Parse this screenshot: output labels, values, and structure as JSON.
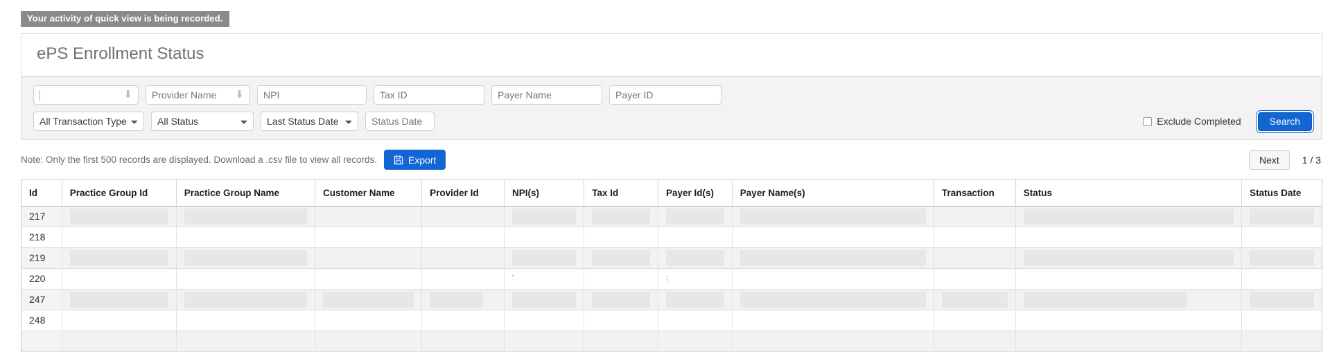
{
  "banner": {
    "text": "Your activity of quick view is being recorded."
  },
  "panel": {
    "title": "ePS Enrollment Status"
  },
  "filters": {
    "row1": [
      {
        "name": "practice-group",
        "type": "typeahead",
        "value": "",
        "placeholder": "",
        "arrow": "⬇"
      },
      {
        "name": "provider-name",
        "type": "typeahead",
        "value": "Provider Name",
        "placeholder": "Provider Name",
        "arrow": "⬇"
      },
      {
        "name": "npi",
        "type": "text",
        "value": "",
        "placeholder": "NPI"
      },
      {
        "name": "tax-id",
        "type": "text",
        "value": "",
        "placeholder": "Tax ID"
      },
      {
        "name": "payer-name",
        "type": "text",
        "value": "",
        "placeholder": "Payer Name"
      },
      {
        "name": "payer-id",
        "type": "text",
        "value": "",
        "placeholder": "Payer ID"
      }
    ],
    "row2": [
      {
        "name": "transaction-type",
        "type": "select",
        "selected": "All Transaction Types",
        "options": [
          "All Transaction Types"
        ]
      },
      {
        "name": "status",
        "type": "select",
        "selected": "All Status",
        "options": [
          "All Status"
        ]
      },
      {
        "name": "date-field",
        "type": "select",
        "selected": "Last Status Date",
        "options": [
          "Last Status Date"
        ]
      },
      {
        "name": "status-date",
        "type": "text",
        "value": "",
        "placeholder": "Status Date"
      }
    ],
    "exclude_completed_label": "Exclude Completed",
    "exclude_completed_checked": false,
    "search_label": "Search"
  },
  "toolbar": {
    "note": "Note: Only the first 500 records are displayed. Download a .csv file to view all records.",
    "export_label": "Export",
    "export_icon": "save-icon",
    "next_label": "Next",
    "page_indicator": "1 / 3"
  },
  "table": {
    "columns": [
      "Id",
      "Practice Group Id",
      "Practice Group Name",
      "Customer Name",
      "Provider Id",
      "NPI(s)",
      "Tax Id",
      "Payer Id(s)",
      "Payer Name(s)",
      "Transaction",
      "Status",
      "Status Date"
    ],
    "rows": [
      {
        "id": "217",
        "striped": true,
        "cells": [
          {
            "redacted": true,
            "fill": 1.0
          },
          {
            "redacted": true,
            "fill": 1.0
          },
          {
            "redacted": false
          },
          {
            "redacted": false
          },
          {
            "redacted": true,
            "fill": 1.0
          },
          {
            "redacted": true,
            "fill": 1.0
          },
          {
            "redacted": true,
            "fill": 1.0
          },
          {
            "redacted": true,
            "fill": 1.0
          },
          {
            "redacted": false
          },
          {
            "redacted": true,
            "fill": 1.0
          },
          {
            "redacted": true,
            "fill": 1.0
          }
        ]
      },
      {
        "id": "218",
        "striped": false,
        "cells": [
          {
            "redacted": false
          },
          {
            "redacted": false
          },
          {
            "redacted": false
          },
          {
            "redacted": false
          },
          {
            "redacted": false
          },
          {
            "redacted": false
          },
          {
            "redacted": false
          },
          {
            "redacted": false
          },
          {
            "redacted": false
          },
          {
            "redacted": false
          },
          {
            "redacted": false
          }
        ]
      },
      {
        "id": "219",
        "striped": true,
        "cells": [
          {
            "redacted": true,
            "fill": 1.0
          },
          {
            "redacted": true,
            "fill": 1.0
          },
          {
            "redacted": false
          },
          {
            "redacted": false
          },
          {
            "redacted": true,
            "fill": 1.0
          },
          {
            "redacted": true,
            "fill": 1.0
          },
          {
            "redacted": true,
            "fill": 1.0
          },
          {
            "redacted": true,
            "fill": 1.0
          },
          {
            "redacted": false
          },
          {
            "redacted": true,
            "fill": 1.0
          },
          {
            "redacted": true,
            "fill": 1.0
          }
        ]
      },
      {
        "id": "220",
        "striped": false,
        "cells": [
          {
            "redacted": false
          },
          {
            "redacted": false
          },
          {
            "redacted": false
          },
          {
            "redacted": false
          },
          {
            "redacted": false,
            "mark": "'"
          },
          {
            "redacted": false
          },
          {
            "redacted": false,
            "mark": ";"
          },
          {
            "redacted": false
          },
          {
            "redacted": false
          },
          {
            "redacted": false
          },
          {
            "redacted": false
          }
        ]
      },
      {
        "id": "247",
        "striped": true,
        "cells": [
          {
            "redacted": true,
            "fill": 1.0
          },
          {
            "redacted": true,
            "fill": 1.0
          },
          {
            "redacted": true,
            "fill": 1.0
          },
          {
            "redacted": true,
            "fill": 0.8
          },
          {
            "redacted": true,
            "fill": 1.0
          },
          {
            "redacted": true,
            "fill": 1.0
          },
          {
            "redacted": true,
            "fill": 1.0
          },
          {
            "redacted": true,
            "fill": 1.0
          },
          {
            "redacted": true,
            "fill": 1.0
          },
          {
            "redacted": true,
            "fill": 0.78
          },
          {
            "redacted": true,
            "fill": 1.0
          }
        ]
      },
      {
        "id": "248",
        "striped": false,
        "cells": [
          {
            "redacted": false
          },
          {
            "redacted": false
          },
          {
            "redacted": false
          },
          {
            "redacted": false
          },
          {
            "redacted": false
          },
          {
            "redacted": false
          },
          {
            "redacted": false
          },
          {
            "redacted": false
          },
          {
            "redacted": false
          },
          {
            "redacted": false
          },
          {
            "redacted": false
          }
        ]
      },
      {
        "id": "",
        "striped": true,
        "partial": true,
        "cells": [
          {
            "redacted": false
          },
          {
            "redacted": false
          },
          {
            "redacted": false
          },
          {
            "redacted": false
          },
          {
            "redacted": false
          },
          {
            "redacted": false
          },
          {
            "redacted": false
          },
          {
            "redacted": false
          },
          {
            "redacted": false
          },
          {
            "redacted": false
          },
          {
            "redacted": false
          }
        ]
      }
    ]
  },
  "colors": {
    "accent": "#1266d4",
    "banner_bg": "#8a8a8a",
    "filter_bg": "#f3f3f3",
    "stripe": "#f2f2f2",
    "redact": "#e7e7e7"
  }
}
